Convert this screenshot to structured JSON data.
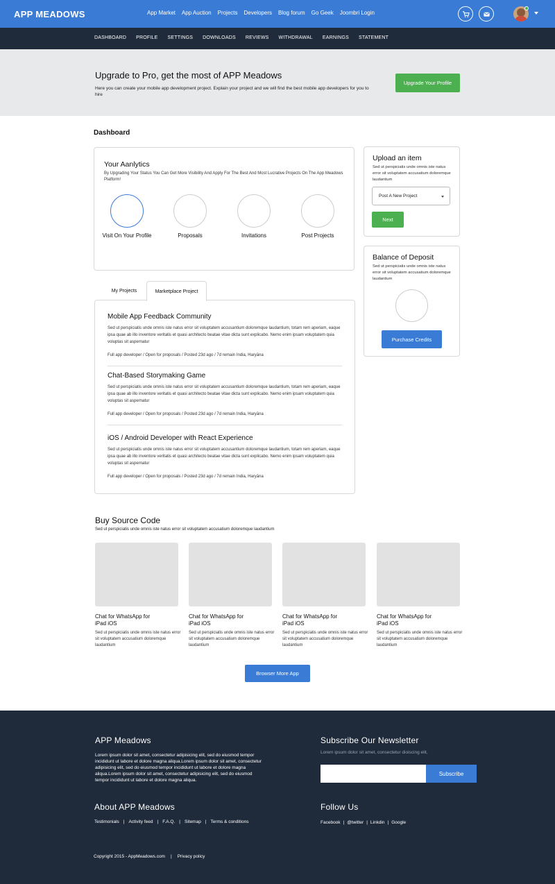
{
  "header": {
    "brand": "APP MEADOWS",
    "nav": [
      "App Market",
      "App Auction",
      "Projects",
      "Developers",
      "Blog forum",
      "Go Geek",
      "Joombri Login"
    ]
  },
  "subnav": [
    "DASHBOARD",
    "PROFILE",
    "SETTINGS",
    "DOWNLOADS",
    "REVIEWS",
    "WITHDRAWAL",
    "EARNINGS",
    "STATEMENT"
  ],
  "promo": {
    "title": "Upgrade to Pro, get the most of APP Meadows",
    "text": "Here you can create your mobile app development project. Explain your project and we will find the best mobile app developers for you to hire",
    "button": "Upgrade Your Profile"
  },
  "dashboard_title": "Dashboard",
  "analytics": {
    "title": "Your Aanlytics",
    "text": "By Upgrading Your Status You Can Get More Visibility And Apply For The  Best And Most Lucrative Projects On The App Meadows Platform!",
    "stats": [
      "Visit On Your Profile",
      "Proposals",
      "Invitations",
      "Post Projects"
    ]
  },
  "upload": {
    "title": "Upload an item",
    "text": "Sed ut perspiciatis unde omnis iste natus error sit voluptatem accusatium doloremque laudantium",
    "select_value": "Post A New Project",
    "button": "Next"
  },
  "balance": {
    "title": "Balance of Deposit",
    "text": "Sed ut perspiciatis unde omnis iste natus error sit voluptatem accusatium doloremque laudantium",
    "button": "Purchase Credits"
  },
  "tabs": [
    "My Projects",
    "Marketplace Project"
  ],
  "projects": [
    {
      "title": "Mobile App Feedback Community",
      "desc": "Sed ut perspiciatis unde omnis iste natus error sit voluptatem accusantium doloremque laudantium, totam rem aperiam, eaque ipsa quae ab illo inventore veritatis et quasi architecto beatae vitae dicta sunt explicabo. Nemo enim ipsam voluptatem quia voluptas sit aspernatur",
      "meta": "Full app developer / Open for proposals / Posted 23d ago  / 7d remain India, Haryāna"
    },
    {
      "title": "Chat-Based Storymaking Game",
      "desc": "Sed ut perspiciatis unde omnis iste natus error sit voluptatem accusantium doloremque laudantium, totam rem aperiam, eaque ipsa quae ab illo inventore veritatis et quasi architecto beatae vitae dicta sunt explicabo. Nemo enim ipsam voluptatem quia voluptas sit aspernatur",
      "meta": "Full app developer / Open for proposals / Posted 23d ago  / 7d remain India, Haryāna"
    },
    {
      "title": "iOS / Android Developer with React Experience",
      "desc": "Sed ut perspiciatis unde omnis iste natus error sit voluptatem accusantium doloremque laudantium, totam rem aperiam, eaque ipsa quae ab illo inventore veritatis et quasi architecto beatae vitae dicta sunt explicabo. Nemo enim ipsam voluptatem quia voluptas sit aspernatur",
      "meta": "Full app developer / Open for proposals / Posted 23d ago  / 7d remain India, Haryāna"
    }
  ],
  "buy": {
    "title": "Buy  Source Code",
    "sub": "Sed ut perspiciatis unde omnis iste natus error sit voluptatem accusatium doloremque laudantium",
    "items": [
      {
        "title": "Chat for WhatsApp for iPad iOS",
        "desc": "Sed ut perspiciatis unde omnis iste natus error sit voluptatem accusatium doloremque laudantium"
      },
      {
        "title": "Chat for WhatsApp for iPad iOS",
        "desc": "Sed ut perspiciatis unde omnis iste natus error sit voluptatem accusatium doloremque laudantium"
      },
      {
        "title": "Chat for WhatsApp for iPad iOS",
        "desc": "Sed ut perspiciatis unde omnis iste natus error sit voluptatem accusatium doloremque laudantium"
      },
      {
        "title": "Chat for WhatsApp for iPad iOS",
        "desc": "Sed ut perspiciatis unde omnis iste natus error sit voluptatem accusatium doloremque laudantium"
      }
    ],
    "button": "Browser More App"
  },
  "footer": {
    "about_title": "APP Meadows",
    "about_text": "Lorem ipsum dolor sit amet, consectetur adipisicing elit, sed do eiusmod tempor incididunt ut labore et dolore magna aliqua.Lorem ipsum dolor sit amet, consectetur adipisicing elit, sed do eiusmod tempor incididunt ut labore et dolore magna aliqua.Lorem ipsum dolor sit amet, consectetur adipisicing elit, sed do eiusmod tempor incididunt ut labore et dolore magna aliqua.",
    "newsletter_title": "Subscribe Our Newsletter",
    "newsletter_text": "Lorem ipsum dolor sit amet, consectetur dioiscing elit,",
    "subscribe_button": "Subscribe",
    "about2_title": "About APP Meadows",
    "about_links": [
      "Testimonials",
      "Activity feed",
      "F.A.Q.",
      "Sitemap",
      "Terms & conditions"
    ],
    "follow_title": "Follow Us",
    "follow_links": [
      "Facebook",
      "@twitter",
      "Linkdin",
      "Google"
    ],
    "copyright": "Copyright 2015 - AppMeadows.com",
    "privacy": "Privacy policy"
  },
  "colors": {
    "primary": "#3a7bd5",
    "dark": "#1f2a3a",
    "green": "#4caf50"
  }
}
